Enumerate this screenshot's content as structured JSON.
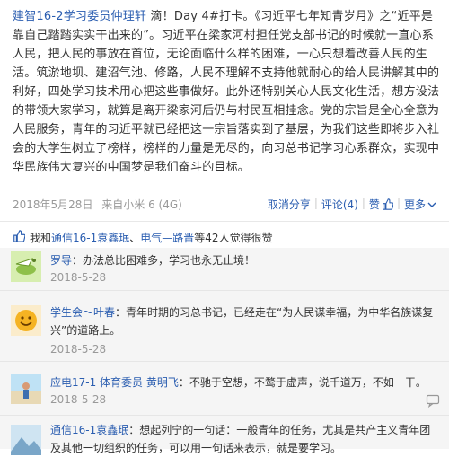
{
  "post": {
    "author": "建智16-2学习委员仲理轩",
    "content": "滴！Day 4#打卡。《习近平七年知青岁月》之“近平是靠自己踏踏实实干出来的”。习近平在梁家河村担任党支部书记的时候就一直心系人民，把人民的事放在首位，无论面临什么样的困难，一心只想着改善人民的生活。筑淤地坝、建沼气池、修路，人民不理解不支持他就耐心的给人民讲解其中的利好，四处学习技术用心把这些事做好。此外还特别关心人民文化生活，想方设法的带领大家学习，就算是离开梁家河后仍与村民互相挂念。党的宗旨是全心全意为人民服务，青年的习近平就已经把这一宗旨落实到了基层，为我们这些即将步入社会的大学生树立了榜样，榜样的力量是无尽的，向习总书记学习心系群众，实现中华民族伟大复兴的中国梦是我们奋斗的目标。"
  },
  "meta": {
    "time": "2018年5月28日",
    "source": "来自小米 6 (4G)",
    "cancel_share": "取消分享",
    "comment": "评论(4)",
    "like": "赞",
    "more": "更多"
  },
  "likes": {
    "prefix": "我和",
    "user1": "通信16-1袁鑫珉",
    "sep": "、",
    "user2": "电气—路晋",
    "suffix": "等42人觉得很赞"
  },
  "comments": [
    {
      "name": "罗导",
      "text": "：办法总比困难多，学习也永无止境！",
      "time": "2018-5-28"
    },
    {
      "name": "学生会～叶春",
      "text": "：青年时期的习总书记，已经走在“为人民谋幸福，为中华名族谋复兴”的道路上。",
      "time": "2018-5-28"
    },
    {
      "name": "应电17-1 体育委员 黄明飞",
      "text": "：不驰于空想，不鹜于虚声，说千道万，不如一干。",
      "time": "2018-5-28"
    },
    {
      "name": "通信16-1袁鑫珉",
      "text": "：想起列宁的一句话：一般青年的任务，尤其是共产主义青年团及其他一切组织的任务，可以用一句话来表示，就是要学习。",
      "time": ""
    }
  ],
  "colors": {
    "link": "#2a5db0",
    "muted": "#999999",
    "comment_bg": "#f5f5f5"
  }
}
